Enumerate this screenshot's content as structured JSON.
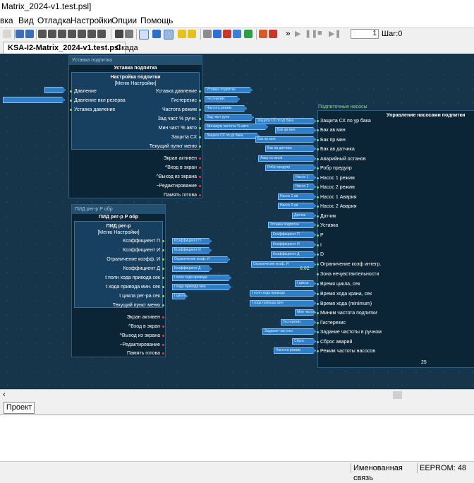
{
  "window": {
    "title": "Matrix_2024-v1.test.psl]"
  },
  "menu": [
    "вка",
    "Вид",
    "Отладка",
    "Настройки",
    "Опции",
    "Помощь"
  ],
  "toolbar": {
    "step_value": "1",
    "step_label": "Шаг:0"
  },
  "tabs": {
    "active": "KSA-I2-Matrix_2024-v1.test.psl",
    "other": "Скада"
  },
  "colors": {
    "canvas_bg": "#17354a",
    "block_bg": "#0c2536",
    "inner_bg": "#163f60",
    "tag": "#2f7fc8",
    "pin_out": "#86e060",
    "pin_state": "#e04040"
  },
  "block1": {
    "header": "Уставка подпитка",
    "title": "Уставка подпитка",
    "inner_title": "Настройка подпитки",
    "inner_subtitle": "[Меню Настройки]",
    "left_ports": [
      "Давление",
      "Давление вкл резерва",
      "Уставка давление"
    ],
    "right_ports": [
      "Уставка давление",
      "Гистерезис",
      "Частота режим",
      "Зад част % ручн.",
      "Мин част % авто",
      "Защита СХ",
      "Текущий пункт меню"
    ],
    "state_ports": [
      "Экран активен",
      "^Вход в экран",
      "^Выход из экрана",
      "~Редактирование",
      "Память готова"
    ],
    "input_tags": [
      "",
      ""
    ],
    "output_tags": [
      "Уставка подпитка",
      "Гистерезис",
      "Частота режим",
      "Зад част ручн",
      "Минимум частоты % авто",
      "Защита СХ по ур бака"
    ]
  },
  "block2": {
    "header": "ПИД рег-р Р обр",
    "title": "ПИД рег-р Р обр",
    "inner_title": "ПИД рег-р",
    "inner_subtitle": "[Меню Настройки]",
    "right_ports": [
      "Коэффициент П",
      "Коэффициент И",
      "Ограничение коэфф. И",
      "Коэффициент Д",
      "t полн хода привода сек",
      "t хода привода мин. сек",
      "t цикла рег-ра сек",
      "Текущий пункт меню"
    ],
    "state_ports": [
      "Экран активен",
      "^Вход в экран",
      "^Выход из экрана",
      "~Редактирование",
      "Память готова"
    ],
    "output_tags": [
      "Коэффициент П",
      "Коэффициент И",
      "Ограничение коэф. И",
      "Коэффициент Д",
      "t полн хода привода",
      "t хода привода мин",
      "t цикла"
    ]
  },
  "block3": {
    "header": "Подпиточные насосы",
    "title": "Управление насосами подпитки",
    "inputs": [
      "Защита СХ по ур бака",
      "Бак ав мин",
      "Бак пр мин",
      "Бак ав датчика",
      "Аварийный останов",
      "Робр предупр",
      "Насос 1 режим",
      "Насос 2 режим",
      "Насос 1 Авария",
      "Насос 2 Авария",
      "Датчик",
      "Уставка",
      "P",
      "I",
      "D",
      "Ограничение коэф интегр.",
      "Зона нечувствительности",
      "Время цикла, сек",
      "Время хода крана, сек",
      "Время хода (minimum)",
      "Миним частота подпитки",
      "Гистерезис",
      "Задание частоты в ручном",
      "Сброс аварий",
      "Режим частоты насосов"
    ],
    "input_tags": [
      "Защита СХ по ур бака",
      "Бак ав мин",
      "Бак пр мин",
      "Бак ав датчика",
      "Авар останов",
      "Робр предупр",
      "Насос 1",
      "Насос 2",
      "Насос 1 ав",
      "Насос 2 ав",
      "Датчик",
      "Уставка подпитка",
      "Коэффициент П",
      "Коэффициент И",
      "Коэффициент Д",
      "Ограничение коэф. И",
      "",
      "t цикла",
      "t полн хода привода",
      "t хода привода мин",
      "Мин частота",
      "Гистерезис",
      "Задание частоты",
      "Сброс",
      "Частота режим"
    ],
    "value_label": "0.02",
    "footer": "25"
  },
  "project_tab": "Проект",
  "status": {
    "named_link": "Именованная связь",
    "eeprom": "EEPROM: 48"
  }
}
